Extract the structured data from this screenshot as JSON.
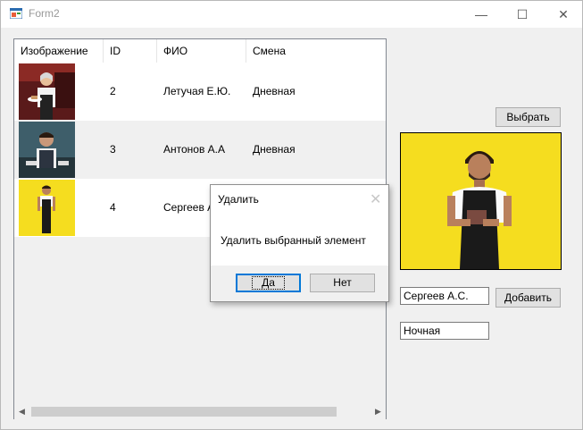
{
  "window": {
    "title": "Form2",
    "minimize_glyph": "—",
    "maximize_glyph": "☐",
    "close_glyph": "✕"
  },
  "grid": {
    "columns": [
      "Изображение",
      "ID",
      "ФИО",
      "Смена"
    ],
    "rows": [
      {
        "id": "2",
        "fio": "Летучая Е.Ю.",
        "shift": "Дневная",
        "image": "waitress-photo"
      },
      {
        "id": "3",
        "fio": "Антонов А.А",
        "shift": "Дневная",
        "image": "waiter-photo"
      },
      {
        "id": "4",
        "fio": "Сергеев А",
        "shift": "",
        "image": "waiter-yellow-photo"
      }
    ],
    "scroll_left_glyph": "◀",
    "scroll_right_glyph": "▶"
  },
  "side": {
    "select_button": "Выбрать",
    "add_button": "Добавить",
    "name_value": "Сергеев А.С.",
    "shift_value": "Ночная"
  },
  "dialog": {
    "title": "Удалить",
    "message": "Удалить выбранный элемент",
    "yes_label": "Да",
    "no_label": "Нет",
    "close_glyph": "✕"
  },
  "colors": {
    "photo_background": "#f5dd1f",
    "selected_row": "#f0f0f0",
    "default_button_border": "#0078d7"
  }
}
